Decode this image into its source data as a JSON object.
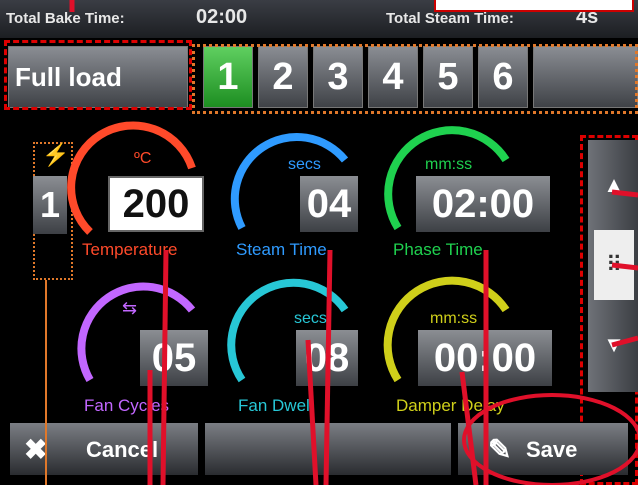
{
  "header": {
    "bake_label": "Total Bake Time:",
    "bake_value": "02:00",
    "steam_label": "Total Steam Time:",
    "steam_value": "4s"
  },
  "load_button": "Full load",
  "phases": [
    "1",
    "2",
    "3",
    "4",
    "5",
    "6"
  ],
  "active_phase": "1",
  "phase_indicator": "1",
  "gauges": {
    "temperature": {
      "unit": "ºC",
      "value": "200",
      "label": "Temperature"
    },
    "steam_time": {
      "unit": "secs",
      "value": "04",
      "label": "Steam Time"
    },
    "phase_time": {
      "unit": "mm:ss",
      "value": "02:00",
      "label": "Phase Time"
    },
    "fan_cycles": {
      "value": "05",
      "label": "Fan Cycles"
    },
    "fan_dwell": {
      "unit": "secs",
      "value": "08",
      "label": "Fan Dwell"
    },
    "damper_delay": {
      "unit": "mm:ss",
      "value": "00:00",
      "label": "Damper Delay"
    }
  },
  "buttons": {
    "cancel": "Cancel",
    "save": "Save"
  },
  "colors": {
    "temperature": "#ff4a2a",
    "steam": "#2f9bff",
    "phase": "#1fd14f",
    "fan": "#c267ff",
    "dwell": "#27c7d6",
    "damper": "#cfcf1a",
    "accent": "#e0102a"
  }
}
